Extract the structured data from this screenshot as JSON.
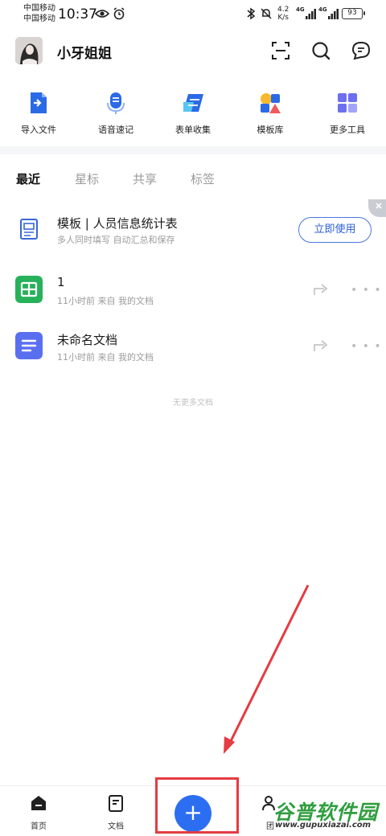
{
  "status_bar": {
    "carrier_1": "中国移动",
    "carrier_2": "中国移动",
    "time": "10:37",
    "speed_value": "4.2",
    "speed_unit": "K/s",
    "signal_1": "4G",
    "signal_2": "4G",
    "battery": "93"
  },
  "header": {
    "username": "小牙姐姐"
  },
  "tools": [
    {
      "label": "导入文件",
      "icon": "import-file-icon"
    },
    {
      "label": "语音速记",
      "icon": "microphone-icon"
    },
    {
      "label": "表单收集",
      "icon": "form-icon"
    },
    {
      "label": "模板库",
      "icon": "template-icon"
    },
    {
      "label": "更多工具",
      "icon": "grid-icon"
    }
  ],
  "tabs": [
    "最近",
    "星标",
    "共享",
    "标签"
  ],
  "active_tab": "最近",
  "template_row": {
    "title": "模板 | 人员信息统计表",
    "subtitle": "多人同时填写 自动汇总和保存",
    "button": "立即使用"
  },
  "docs": [
    {
      "title": "1",
      "subtitle": "11小时前  来自 我的文档",
      "type": "sheet",
      "color": "#27b15a"
    },
    {
      "title": "未命名文档",
      "subtitle": "11小时前  来自 我的文档",
      "type": "doc",
      "color": "#5a6ff0"
    }
  ],
  "no_more": "无更多文档",
  "bottom_nav": {
    "home": "首页",
    "docs": "文档",
    "team": "团",
    "fab": "+"
  },
  "watermark": {
    "text": "谷普软件园",
    "url": "www.gupuxiazai.com"
  },
  "colors": {
    "accent": "#2c6ef2",
    "annotation": "#e53b42"
  }
}
